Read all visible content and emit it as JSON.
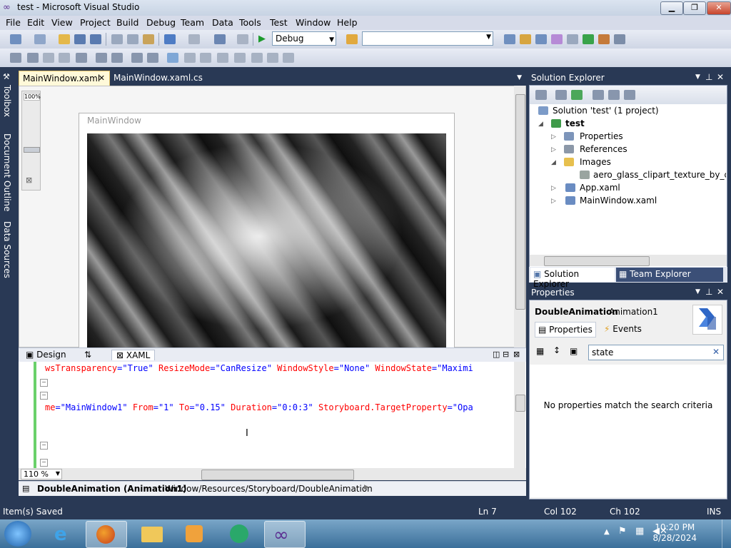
{
  "window": {
    "title": "test - Microsoft Visual Studio"
  },
  "menu": [
    "File",
    "Edit",
    "View",
    "Project",
    "Build",
    "Debug",
    "Team",
    "Data",
    "Tools",
    "Test",
    "Window",
    "Help"
  ],
  "toolbar": {
    "configuration": "Debug",
    "platform": ""
  },
  "left_rail": [
    "Toolbox",
    "Document Outline",
    "Data Sources"
  ],
  "doc_tabs": [
    {
      "label": "MainWindow.xaml",
      "active": true
    },
    {
      "label": "MainWindow.xaml.cs",
      "active": false
    }
  ],
  "designer": {
    "zoom_indicator": "100%",
    "window_title": "MainWindow"
  },
  "split": {
    "design_label": "Design",
    "swap_label": "⇅",
    "xaml_label": "XAML"
  },
  "editor": {
    "line1": [
      {
        "t": "wsTransparency",
        "c": "attr"
      },
      {
        "t": "=\"",
        "c": "val"
      },
      {
        "t": "True",
        "c": "val"
      },
      {
        "t": "\" ",
        "c": "val"
      },
      {
        "t": "ResizeMode",
        "c": "attr"
      },
      {
        "t": "=\"CanResize\" ",
        "c": "val"
      },
      {
        "t": "WindowStyle",
        "c": "attr"
      },
      {
        "t": "=\"None\" ",
        "c": "val"
      },
      {
        "t": "WindowState",
        "c": "attr"
      },
      {
        "t": "=\"Maximi",
        "c": "val"
      }
    ],
    "line2": [
      {
        "t": "me",
        "c": "attr"
      },
      {
        "t": "=\"MainWindow1\" ",
        "c": "val"
      },
      {
        "t": "From",
        "c": "attr"
      },
      {
        "t": "=\"1\" ",
        "c": "val"
      },
      {
        "t": "To",
        "c": "attr"
      },
      {
        "t": "=\"0.15\" ",
        "c": "val"
      },
      {
        "t": "Duration",
        "c": "attr"
      },
      {
        "t": "=\"0:0:3\" ",
        "c": "val"
      },
      {
        "t": "Storyboard.TargetProperty",
        "c": "attr"
      },
      {
        "t": "=\"Opa",
        "c": "val"
      }
    ],
    "zoom": "110 %"
  },
  "breadcrumb": {
    "element": "DoubleAnimation (Animation1)",
    "path": "Window/Resources/Storyboard/DoubleAnimation"
  },
  "solution_explorer": {
    "title": "Solution Explorer",
    "items": [
      {
        "label": "Solution 'test' (1 project)"
      },
      {
        "label": "test"
      },
      {
        "label": "Properties"
      },
      {
        "label": "References"
      },
      {
        "label": "Images"
      },
      {
        "label": "aero_glass_clipart_texture_by_diamo"
      },
      {
        "label": "App.xaml"
      },
      {
        "label": "MainWindow.xaml"
      }
    ],
    "tabs": [
      "Solution Explorer",
      "Team Explorer"
    ]
  },
  "properties": {
    "title": "Properties",
    "object_type": "DoubleAnimation",
    "object_name": "Animation1",
    "tab_properties": "Properties",
    "tab_events": "Events",
    "search_value": "state",
    "empty_message": "No properties match the search criteria"
  },
  "status": {
    "message": "Item(s) Saved",
    "ln": "Ln 7",
    "col": "Col 102",
    "ch": "Ch 102",
    "mode": "INS"
  },
  "taskbar": {
    "time": "10:20 PM",
    "date": "8/28/2024"
  }
}
